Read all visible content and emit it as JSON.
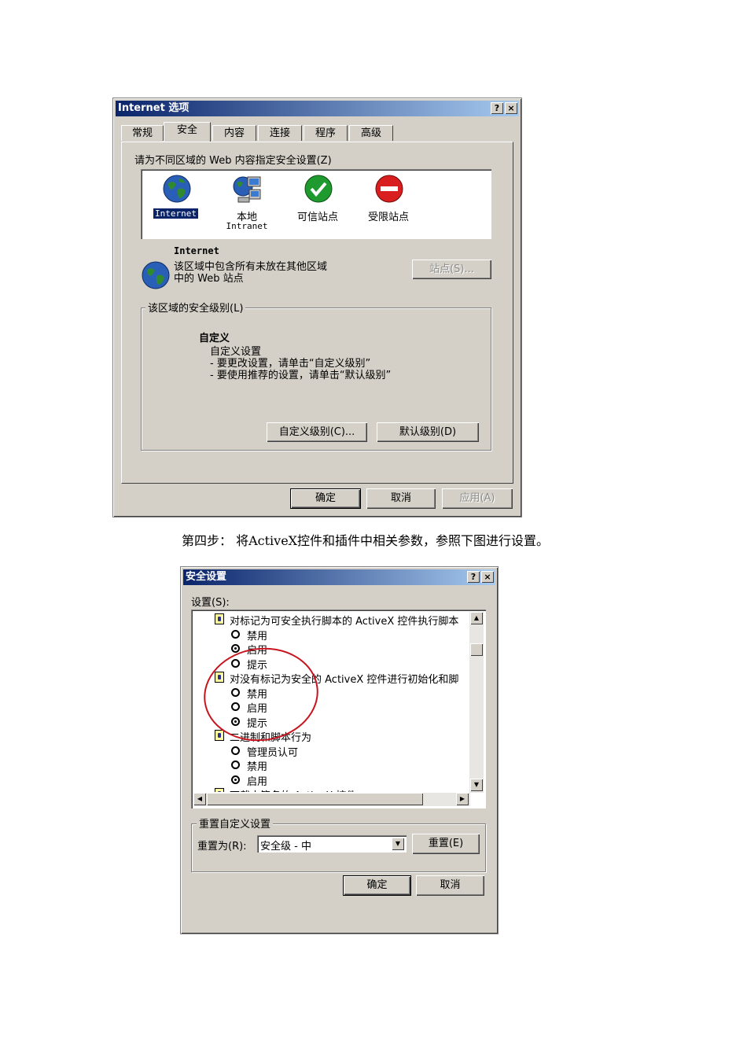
{
  "dialog1": {
    "title": "Internet 选项",
    "help_btn": "?",
    "close_btn": "×",
    "tabs": [
      "常规",
      "安全",
      "内容",
      "连接",
      "程序",
      "高级"
    ],
    "zone_prompt": "请为不同区域的 Web 内容指定安全设置(Z)",
    "zones": [
      {
        "label": "Internet",
        "label2": ""
      },
      {
        "label": "本地",
        "label2": "Intranet"
      },
      {
        "label": "可信站点",
        "label2": ""
      },
      {
        "label": "受限站点",
        "label2": ""
      }
    ],
    "zone_name": "Internet",
    "zone_desc_line1": "该区域中包含所有未放在其他区域",
    "zone_desc_line2": "中的 Web 站点",
    "sites_btn": "站点(S)...",
    "level_group": "该区域的安全级别(L)",
    "level_title": "自定义",
    "level_line1": "自定义设置",
    "level_line2": "- 要更改设置，请单击“自定义级别”",
    "level_line3": "- 要使用推荐的设置，请单击“默认级别”",
    "custom_btn": "自定义级别(C)...",
    "default_btn": "默认级别(D)",
    "ok": "确定",
    "cancel": "取消",
    "apply": "应用(A)"
  },
  "caption": "第四步： 将ActiveX控件和插件中相关参数，参照下图进行设置。",
  "dialog2": {
    "title": "安全设置",
    "help_btn": "?",
    "close_btn": "×",
    "settings_label": "设置(S):",
    "items": [
      {
        "type": "header",
        "text": "对标记为可安全执行脚本的 ActiveX 控件执行脚本"
      },
      {
        "type": "option",
        "text": "禁用",
        "checked": false
      },
      {
        "type": "option",
        "text": "启用",
        "checked": true
      },
      {
        "type": "option",
        "text": "提示",
        "checked": false
      },
      {
        "type": "header",
        "text": "对没有标记为安全的 ActiveX 控件进行初始化和脚"
      },
      {
        "type": "option",
        "text": "禁用",
        "checked": false
      },
      {
        "type": "option",
        "text": "启用",
        "checked": false
      },
      {
        "type": "option",
        "text": "提示",
        "checked": true
      },
      {
        "type": "header",
        "text": "二进制和脚本行为"
      },
      {
        "type": "option",
        "text": "管理员认可",
        "checked": false
      },
      {
        "type": "option",
        "text": "禁用",
        "checked": false
      },
      {
        "type": "option",
        "text": "启用",
        "checked": true
      },
      {
        "type": "header",
        "text": "下载未签名的 ActiveX 控件"
      }
    ],
    "reset_group": "重置自定义设置",
    "reset_to_label": "重置为(R):",
    "reset_value": "安全级 - 中",
    "reset_btn": "重置(E)",
    "ok": "确定",
    "cancel": "取消"
  }
}
